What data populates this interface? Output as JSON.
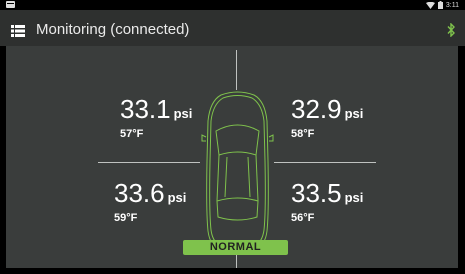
{
  "app": {
    "title": "Monitoring (connected)",
    "menu_icon": "list-icon",
    "bluetooth_icon": "bluetooth-icon",
    "accent": "#7fc24c"
  },
  "statusbar": {
    "time": "3:11"
  },
  "tires": {
    "front_left": {
      "pressure": "33.1",
      "unit": "psi",
      "temp": "57°F"
    },
    "front_right": {
      "pressure": "32.9",
      "unit": "psi",
      "temp": "58°F"
    },
    "rear_left": {
      "pressure": "33.6",
      "unit": "psi",
      "temp": "59°F"
    },
    "rear_right": {
      "pressure": "33.5",
      "unit": "psi",
      "temp": "56°F"
    }
  },
  "status": {
    "label": "NORMAL",
    "color": "#7fc24c"
  }
}
